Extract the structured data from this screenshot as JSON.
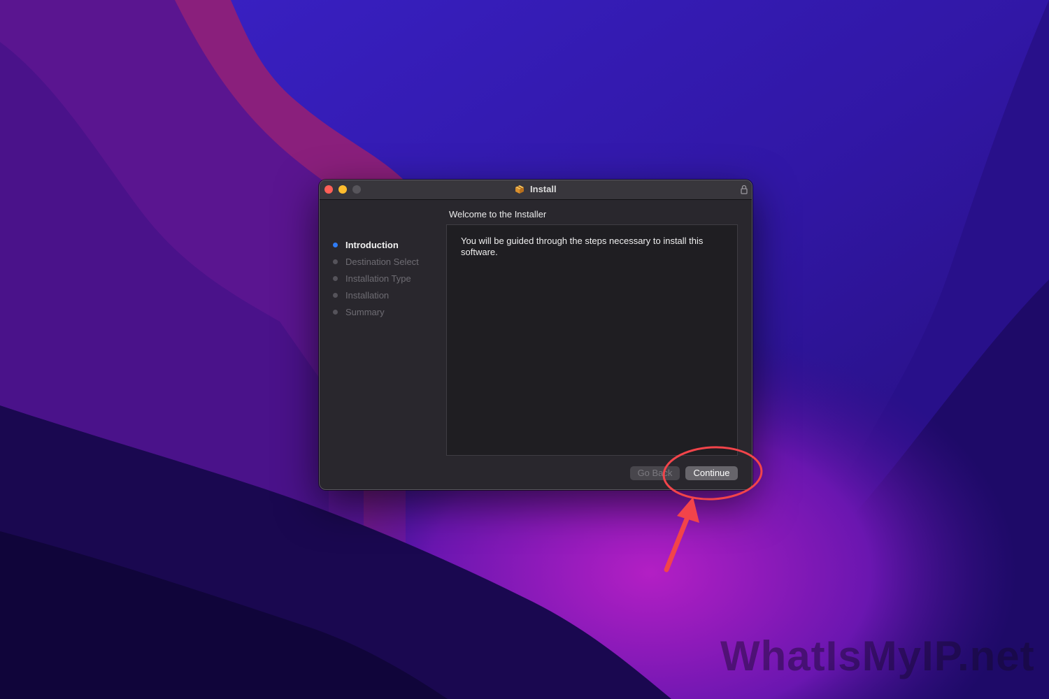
{
  "window": {
    "title": "Install",
    "heading": "Welcome to the  Installer",
    "body_text": "You will be guided through the steps necessary to install this software."
  },
  "steps": [
    {
      "label": "Introduction",
      "state": "active"
    },
    {
      "label": "Destination Select",
      "state": "pending"
    },
    {
      "label": "Installation Type",
      "state": "pending"
    },
    {
      "label": "Installation",
      "state": "pending"
    },
    {
      "label": "Summary",
      "state": "pending"
    }
  ],
  "buttons": {
    "go_back": "Go Back",
    "continue": "Continue"
  },
  "watermark": "WhatIsMyIP.net",
  "colors": {
    "active_step_dot": "#2f7cf6",
    "annotation": "#f2444a",
    "close": "#ff5f57",
    "minimize": "#febc2e"
  }
}
